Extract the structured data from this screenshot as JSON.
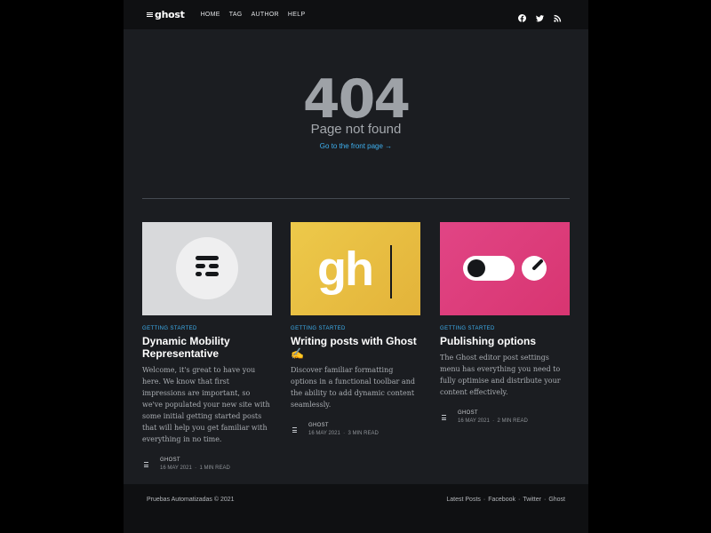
{
  "header": {
    "logo_text": "ghost",
    "nav": [
      "HOME",
      "TAG",
      "AUTHOR",
      "HELP"
    ],
    "social_icons": [
      "facebook-icon",
      "twitter-icon",
      "rss-icon"
    ]
  },
  "error": {
    "code": "404",
    "message": "Page not found",
    "link": "Go to the front page →"
  },
  "posts": [
    {
      "tag": "GETTING STARTED",
      "title": "Dynamic Mobility Representative",
      "excerpt": "Welcome, it's great to have you here. We know that first impressions are important, so we've populated your new site with some initial getting started posts that will help you get familiar with everything in no time.",
      "author": "GHOST",
      "date": "16 MAY 2021",
      "read_time": "1 MIN READ",
      "image_bg": "#d8d9db"
    },
    {
      "tag": "GETTING STARTED",
      "title": "Writing posts with Ghost ✍️",
      "excerpt": "Discover familiar formatting options in a functional toolbar and the ability to add dynamic content seamlessly.",
      "author": "GHOST",
      "date": "16 MAY 2021",
      "read_time": "3 MIN READ",
      "image_bg": "#e6be44",
      "image_text": "gh"
    },
    {
      "tag": "GETTING STARTED",
      "title": "Publishing options",
      "excerpt": "The Ghost editor post settings menu has everything you need to fully optimise and distribute your content effectively.",
      "author": "GHOST",
      "date": "16 MAY 2021",
      "read_time": "2 MIN READ",
      "image_bg": "#dd3e7e"
    }
  ],
  "footer": {
    "copyright": "Pruebas Automatizadas © 2021",
    "links": [
      "Latest Posts",
      "Facebook",
      "Twitter",
      "Ghost"
    ]
  },
  "colors": {
    "accent": "#3eb0ef",
    "background": "#1b1d21",
    "header": "#0f1012"
  }
}
